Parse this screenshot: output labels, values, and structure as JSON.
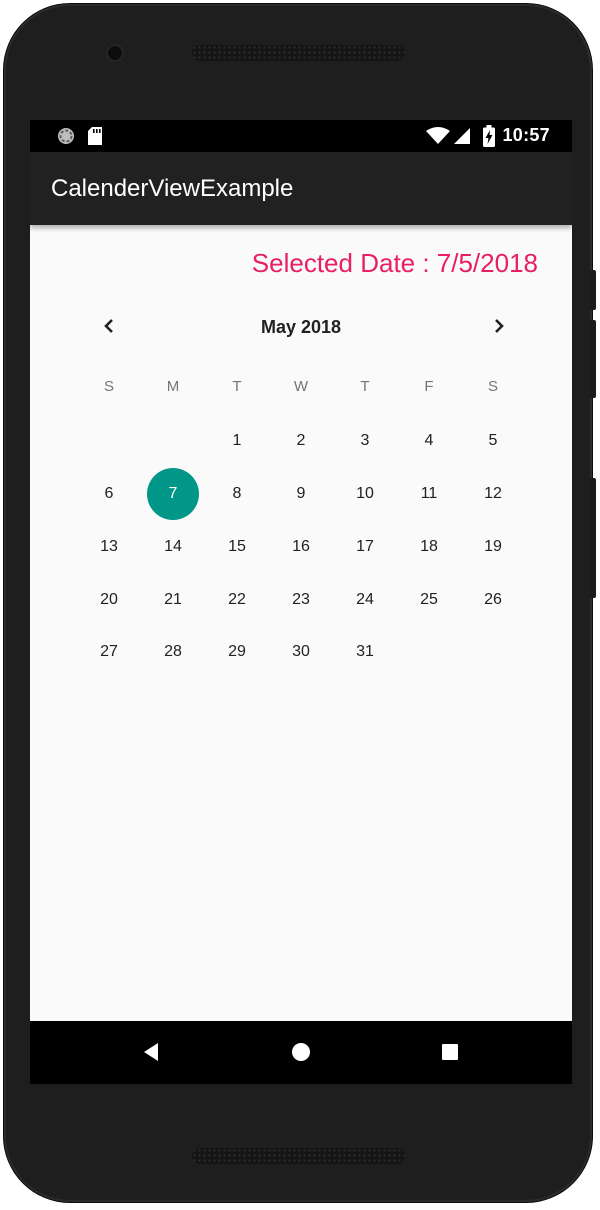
{
  "colors": {
    "accent": "#009688",
    "selected_date_text": "#e91e63",
    "app_bar": "#212121",
    "status_bar": "#000000"
  },
  "status_bar": {
    "time": "10:57",
    "icons": [
      "sync-icon",
      "sd-card-icon",
      "wifi-icon",
      "cell-signal-icon",
      "battery-charging-icon"
    ]
  },
  "app_bar": {
    "title": "CalenderViewExample"
  },
  "selected_date": {
    "text": "Selected Date : 7/5/2018"
  },
  "calendar": {
    "month_label": "May 2018",
    "prev_icon": "chevron-left-icon",
    "next_icon": "chevron-right-icon",
    "weekdays": [
      "S",
      "M",
      "T",
      "W",
      "T",
      "F",
      "S"
    ],
    "leading_blanks": 2,
    "days": [
      "1",
      "2",
      "3",
      "4",
      "5",
      "6",
      "7",
      "8",
      "9",
      "10",
      "11",
      "12",
      "13",
      "14",
      "15",
      "16",
      "17",
      "18",
      "19",
      "20",
      "21",
      "22",
      "23",
      "24",
      "25",
      "26",
      "27",
      "28",
      "29",
      "30",
      "31"
    ],
    "selected_day": "7"
  },
  "nav_bar": {
    "icons": [
      "back-icon",
      "home-icon",
      "recents-icon"
    ]
  }
}
